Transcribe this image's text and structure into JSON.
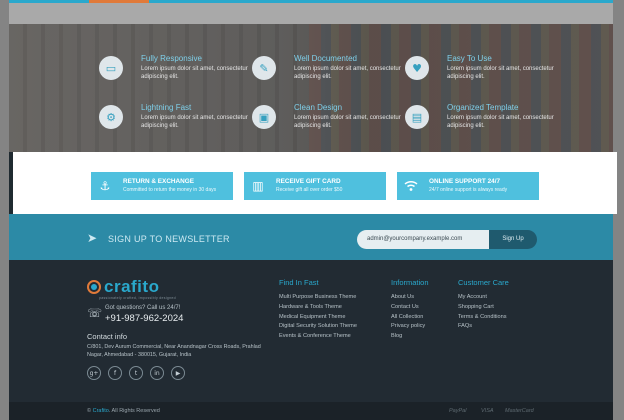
{
  "features": [
    {
      "icon": "monitor-icon",
      "title": "Fully Responsive",
      "desc": "Lorem ipsum dolor sit amet, consectetur adipiscing elit."
    },
    {
      "icon": "pencil-icon",
      "title": "Well Documented",
      "desc": "Lorem ipsum dolor sit amet, consectetur adipiscing elit."
    },
    {
      "icon": "heart-icon",
      "title": "Easy To Use",
      "desc": "Lorem ipsum dolor sit amet, consectetur adipiscing elit."
    },
    {
      "icon": "gear-icon",
      "title": "Lightning Fast",
      "desc": "Lorem ipsum dolor sit amet, consectetur adipiscing elit."
    },
    {
      "icon": "image-icon",
      "title": "Clean Design",
      "desc": "Lorem ipsum dolor sit amet, consectetur adipiscing elit."
    },
    {
      "icon": "file-icon",
      "title": "Organized Template",
      "desc": "Lorem ipsum dolor sit amet, consectetur adipiscing elit."
    }
  ],
  "services": [
    {
      "icon": "anchor-icon",
      "title": "RETURN & EXCHANGE",
      "desc": "Committed to return the money in 30 days"
    },
    {
      "icon": "gift-icon",
      "title": "RECEIVE GIFT CARD",
      "desc": "Receive gift all over order $50"
    },
    {
      "icon": "wifi-icon",
      "title": "ONLINE SUPPORT 24/7",
      "desc": "24/7 online support is always ready"
    }
  ],
  "newsletter": {
    "title": "SIGN UP TO NEWSLETTER",
    "email_value": "admin@yourcompany.example.com",
    "button": "Sign Up"
  },
  "footer": {
    "logo_text": "crafito",
    "logo_tagline": "passionately crafted, impossibly designed",
    "question": "Got questions? Call us 24/7!",
    "phone": "+91-987-962-2024",
    "contact_title": "Contact info",
    "address": "C/801, Dev Aurum Commercial, Near Anandnagar Cross Roads, Prahlad Nagar, Ahmedabad - 380015, Gujarat, India",
    "columns": [
      {
        "title": "Find In Fast",
        "items": [
          "Multi Purpose Business Theme",
          "Hardware & Tools Theme",
          "Medical Equipment Theme",
          "Digital Security Solution Theme",
          "Events & Conference Theme"
        ]
      },
      {
        "title": "Information",
        "items": [
          "About Us",
          "Contact Us",
          "All Collection",
          "Privacy policy",
          "Blog"
        ]
      },
      {
        "title": "Customer Care",
        "items": [
          "My Account",
          "Shopping Cart",
          "Terms & Conditions",
          "FAQs"
        ]
      }
    ],
    "social": [
      {
        "icon": "google-plus-icon",
        "glyph": "g+"
      },
      {
        "icon": "facebook-icon",
        "glyph": "f"
      },
      {
        "icon": "twitter-icon",
        "glyph": "t"
      },
      {
        "icon": "linkedin-icon",
        "glyph": "in"
      },
      {
        "icon": "youtube-icon",
        "glyph": "▶"
      }
    ]
  },
  "bottom": {
    "copyright_prefix": "© ",
    "copyright_brand": "Crafito",
    "copyright_suffix": ". All Rights Reserved",
    "payments": [
      "PayPal",
      "VISA",
      "MasterCard"
    ]
  }
}
